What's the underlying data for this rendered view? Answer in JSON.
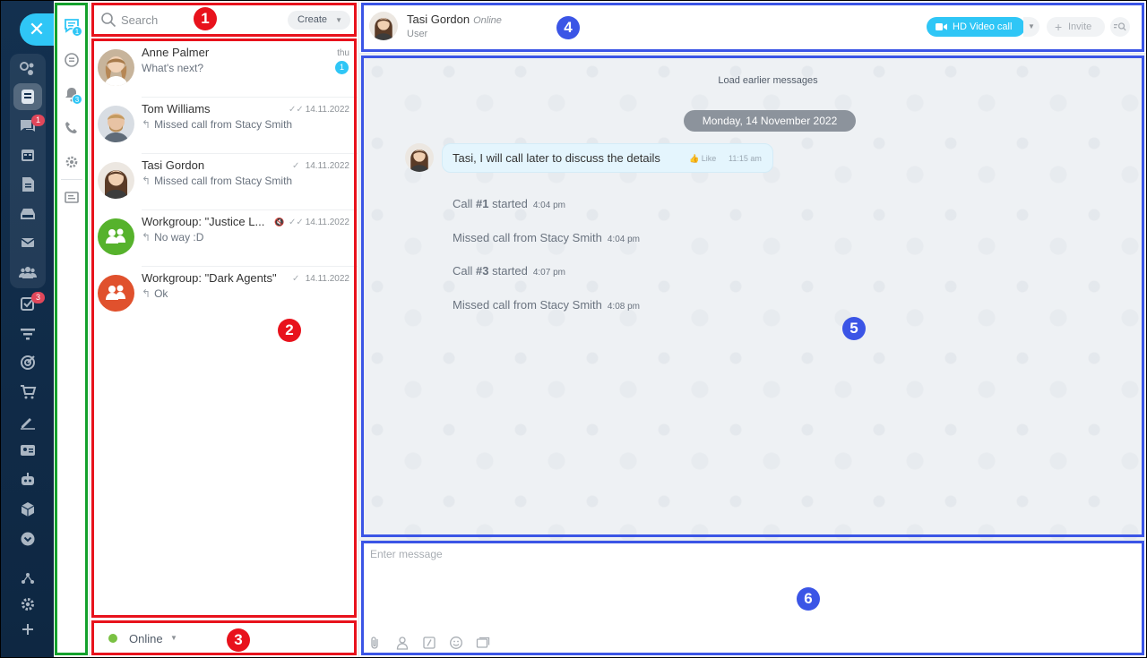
{
  "rail": {
    "close_icon": "close-icon",
    "badges": {
      "messages": "1",
      "tasks": "3"
    },
    "icons": [
      "activity-icon",
      "chat-icon",
      "messages-icon",
      "calendar-icon",
      "documents-icon",
      "drive-icon",
      "mail-icon",
      "groups-icon",
      "tasks-icon",
      "filter-icon",
      "target-icon",
      "cart-icon",
      "sign-icon",
      "contact-card-icon",
      "robot-icon",
      "box-icon",
      "more-icon",
      "structure-icon",
      "settings-icon",
      "add-icon"
    ]
  },
  "subnav": {
    "badges": {
      "chats": "1",
      "notifications": "3"
    },
    "icons": [
      "chats-icon",
      "openlines-icon",
      "notifications-icon",
      "phone-icon",
      "settings-icon",
      "tasks-list-icon"
    ]
  },
  "search": {
    "placeholder": "Search",
    "create_label": "Create"
  },
  "recent": [
    {
      "name": "Anne Palmer",
      "message": "What's next?",
      "date": "thu",
      "unread": "1",
      "avatar": "photo-woman-1",
      "reply": false
    },
    {
      "name": "Tom Williams",
      "message": "Missed call from Stacy Smith",
      "date": "14.11.2022",
      "avatar": "photo-man-1",
      "reply": true,
      "status": "read"
    },
    {
      "name": "Tasi Gordon",
      "message": "Missed call from Stacy Smith",
      "date": "14.11.2022",
      "avatar": "photo-woman-2",
      "reply": true,
      "status": "sent"
    },
    {
      "name": "Workgroup: \"Justice L...",
      "message": "No way :D",
      "date": "14.11.2022",
      "avatar": "group-green",
      "reply": true,
      "status": "read",
      "muted": true
    },
    {
      "name": "Workgroup: \"Dark Agents\"",
      "message": "Ok",
      "date": "14.11.2022",
      "avatar": "group-orange",
      "reply": true,
      "status": "sent"
    }
  ],
  "status": {
    "label": "Online",
    "color": "#7ac143"
  },
  "header": {
    "name": "Tasi Gordon",
    "status": "Online",
    "role": "User",
    "video_label": "HD Video call",
    "invite_label": "Invite"
  },
  "chat": {
    "load_earlier": "Load earlier messages",
    "date": "Monday, 14 November 2022",
    "bubble": {
      "text": "Tasi, I will call later to discuss the details",
      "like": "Like",
      "time": "11:15 am"
    },
    "system": [
      {
        "prefix": "Call ",
        "bold": "#1",
        "suffix": " started",
        "time": "4:04 pm"
      },
      {
        "prefix": "Missed call from Stacy Smith",
        "bold": "",
        "suffix": "",
        "time": "4:04 pm"
      },
      {
        "prefix": "Call ",
        "bold": "#3",
        "suffix": " started",
        "time": "4:07 pm"
      },
      {
        "prefix": "Missed call from Stacy Smith",
        "bold": "",
        "suffix": "",
        "time": "4:08 pm"
      }
    ]
  },
  "composer": {
    "placeholder": "Enter message",
    "tools": [
      "attach-icon",
      "mention-icon",
      "command-icon",
      "smile-icon",
      "gallery-icon"
    ]
  },
  "annotations": {
    "labels": [
      "1",
      "2",
      "3",
      "4",
      "5",
      "6"
    ],
    "colors": {
      "red": "#e8121c",
      "blue": "#3b55e6",
      "green": "#14a12c"
    }
  },
  "colors": {
    "accent": "#2fc6f6",
    "rail": "#13304f",
    "badge_red": "#e0475a"
  }
}
